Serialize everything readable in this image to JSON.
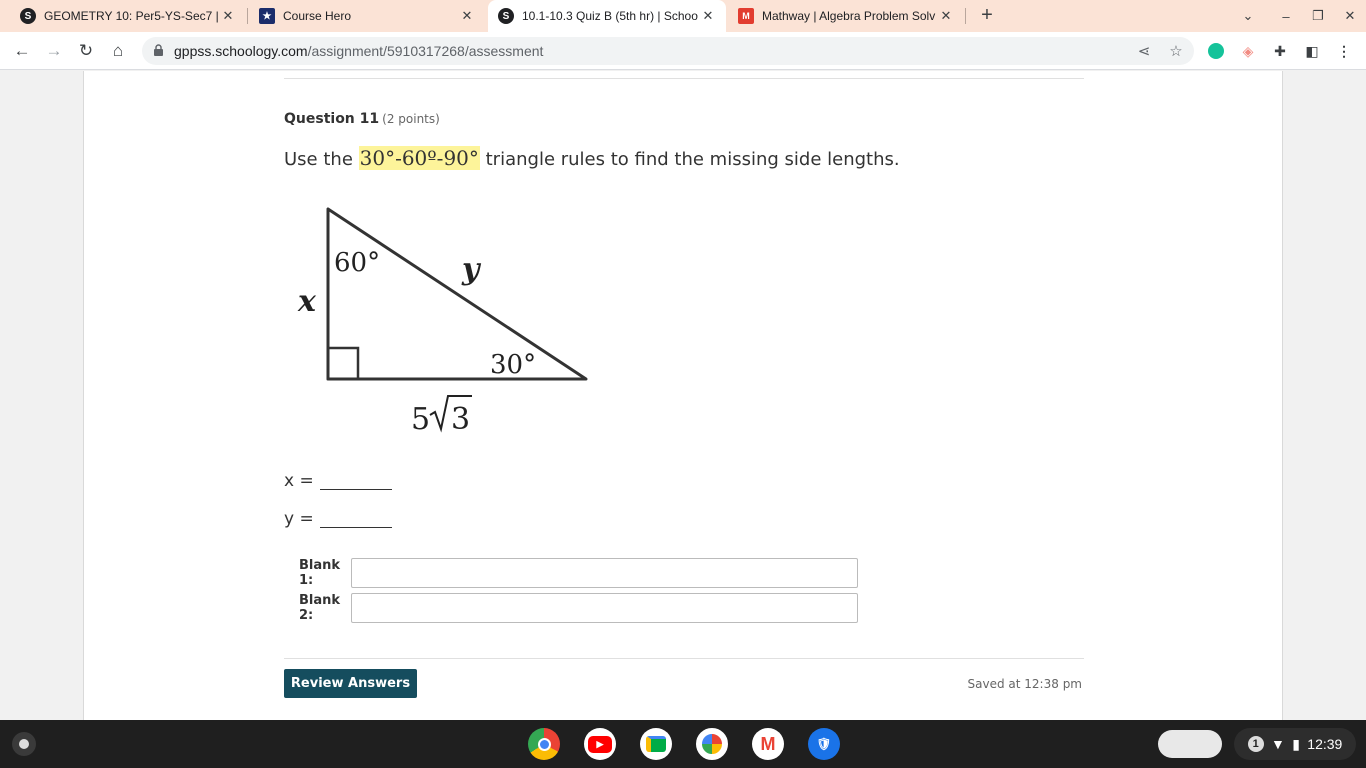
{
  "tabs": [
    {
      "title": "GEOMETRY 10: Per5-YS-Sec7 | Sc",
      "favicon": "schoology-icon",
      "active": false
    },
    {
      "title": "Course Hero",
      "favicon": "course-hero-icon",
      "active": false
    },
    {
      "title": "10.1-10.3 Quiz B (5th hr) | Schoo",
      "favicon": "schoology-icon",
      "active": true
    },
    {
      "title": "Mathway | Algebra Problem Solv",
      "favicon": "mathway-icon",
      "active": false
    }
  ],
  "address": {
    "host": "gppss.schoology.com",
    "path": "/assignment/5910317268/assessment"
  },
  "question": {
    "number_label": "Question 11",
    "points": "(2 points)",
    "prefix": "Use the ",
    "highlight": "30°-60º-90°",
    "suffix": " triangle rules to find the missing side lengths."
  },
  "figure": {
    "angle_top": "60°",
    "angle_right": "30°",
    "side_left": "x",
    "side_hyp": "y",
    "side_bottom_coef": "5",
    "side_bottom_radicand": "3"
  },
  "equations": [
    {
      "label": "x ="
    },
    {
      "label": "y ="
    }
  ],
  "blanks": [
    {
      "label": "Blank 1:",
      "value": ""
    },
    {
      "label": "Blank 2:",
      "value": ""
    }
  ],
  "review_button": "Review Answers",
  "saved_status": "Saved at 12:38 pm",
  "shelf": {
    "apps": [
      "chrome-icon",
      "youtube-icon",
      "meet-icon",
      "photos-icon",
      "gmail-icon",
      "shield-icon"
    ],
    "notification_count": "1",
    "time": "12:39"
  }
}
